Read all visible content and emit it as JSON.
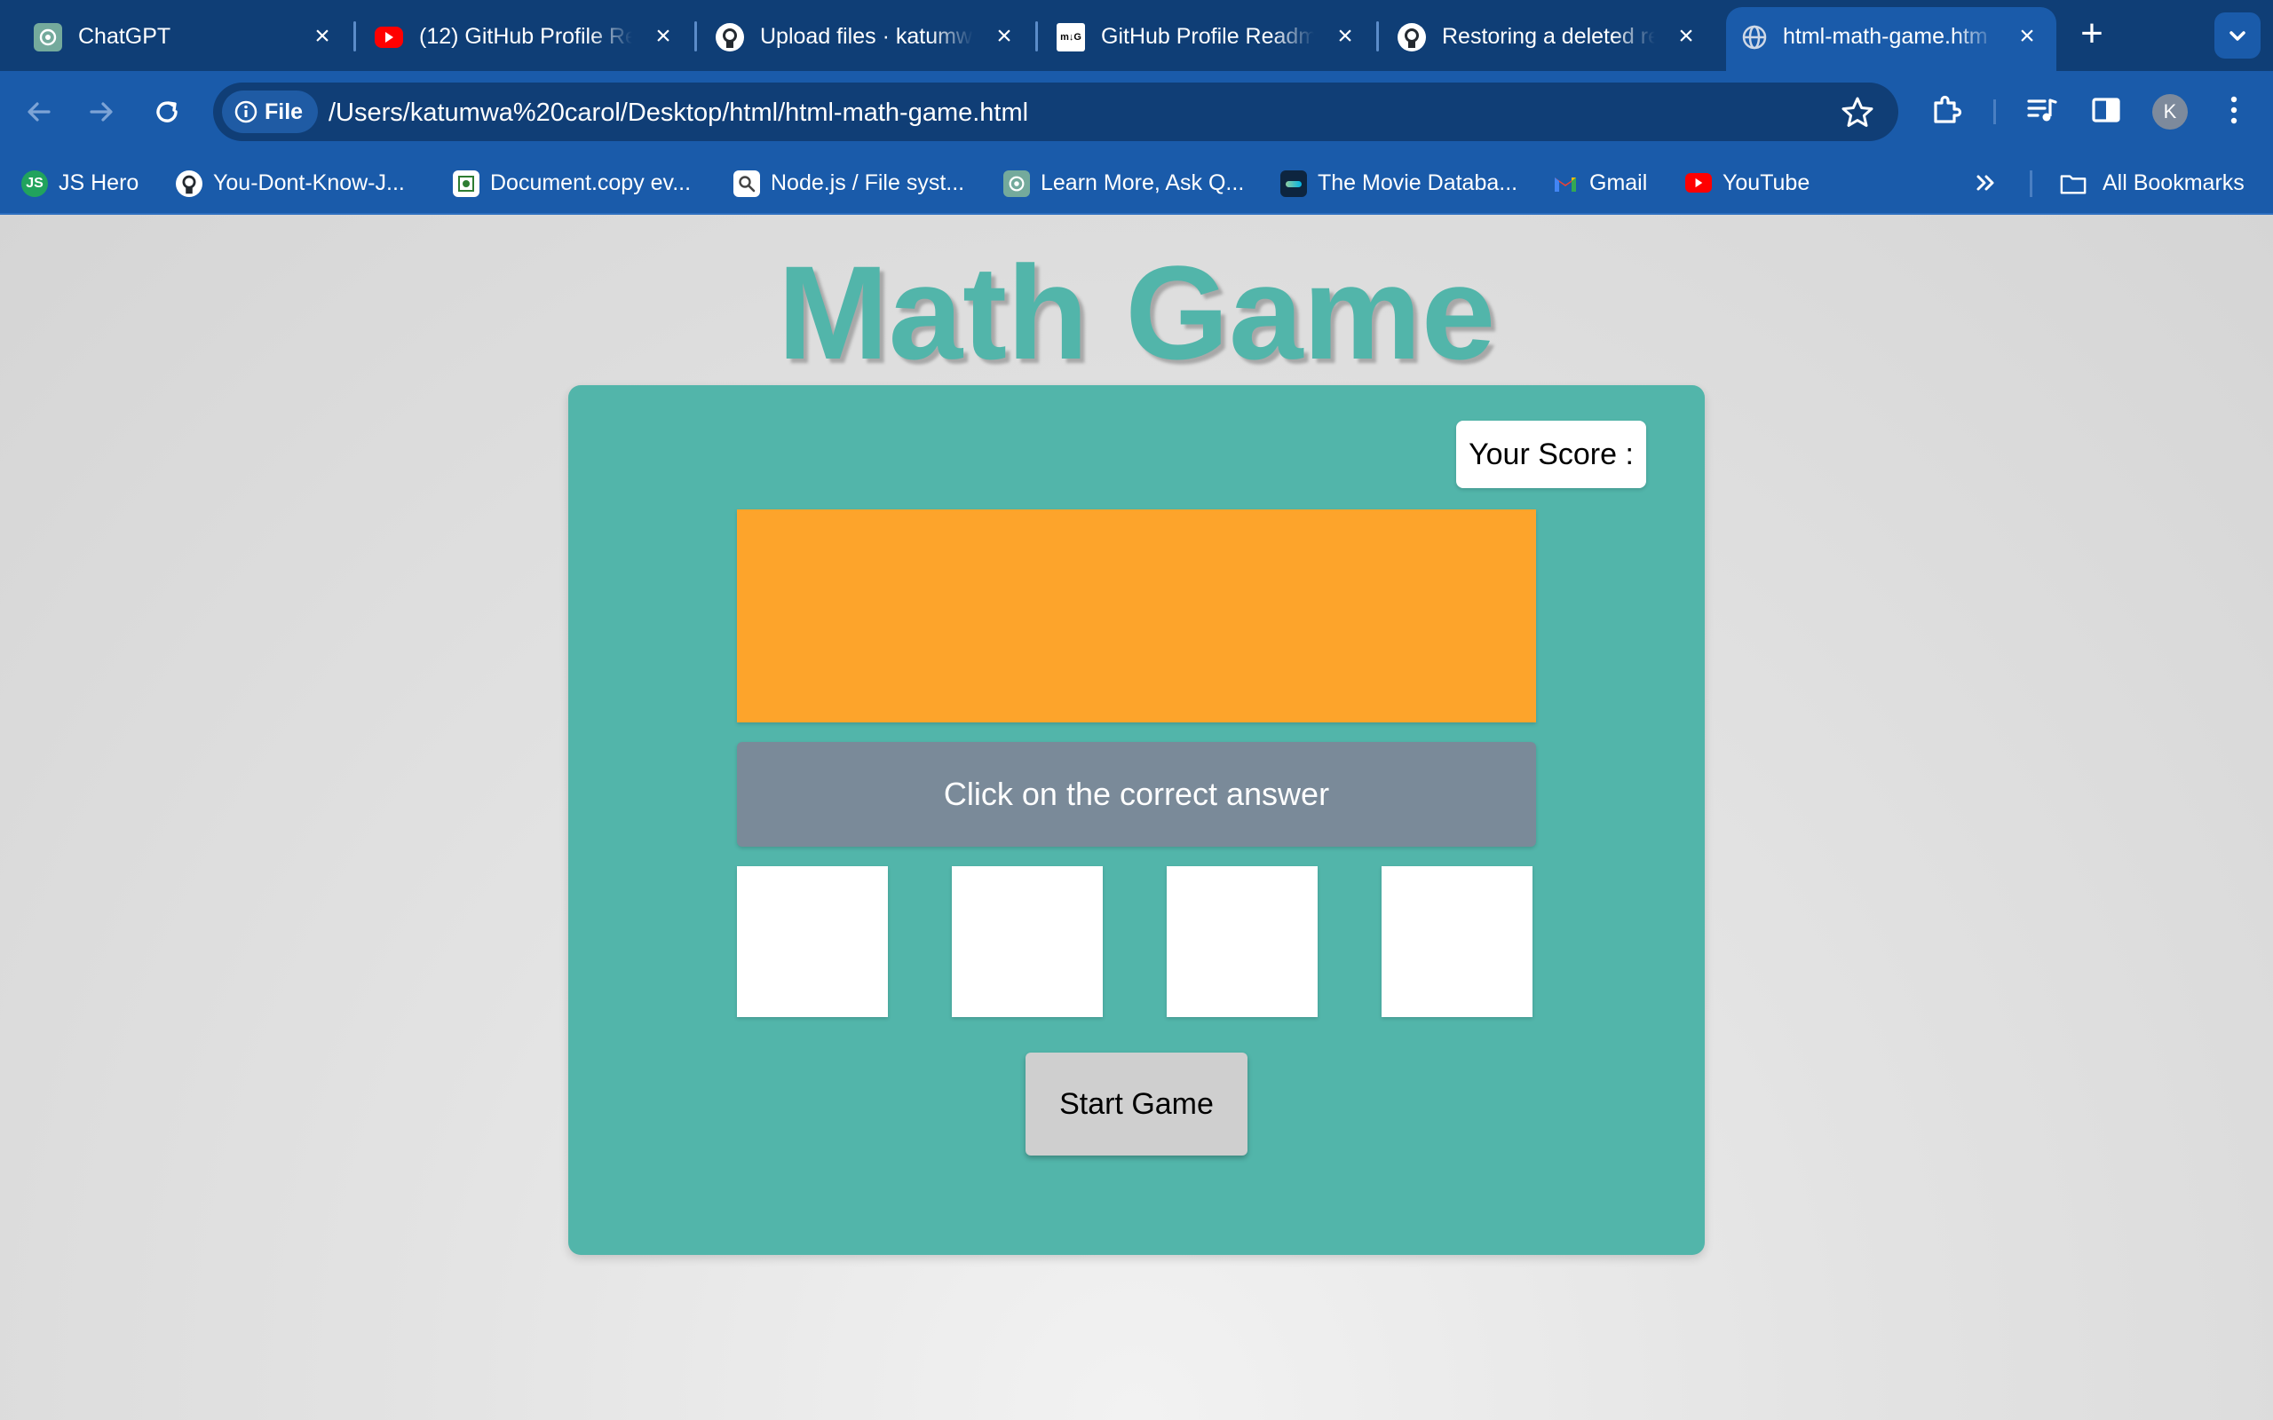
{
  "browser": {
    "tabs": [
      {
        "title": "ChatGPT",
        "icon": "chatgpt-icon",
        "active": false
      },
      {
        "title": "(12) GitHub Profile Re",
        "icon": "youtube-icon",
        "active": false
      },
      {
        "title": "Upload files · katumw",
        "icon": "github-icon",
        "active": false
      },
      {
        "title": "GitHub Profile Readm",
        "icon": "markdown-icon",
        "active": false
      },
      {
        "title": "Restoring a deleted re",
        "icon": "github-icon",
        "active": false
      },
      {
        "title": "html-math-game.htm",
        "icon": "globe-icon",
        "active": true
      }
    ],
    "address": {
      "chip_label": "File",
      "url": "/Users/katumwa%20carol/Desktop/html/html-math-game.html"
    },
    "profile_initial": "K",
    "bookmarks": [
      {
        "label": "JS Hero",
        "icon": "js-hero-icon"
      },
      {
        "label": "You-Dont-Know-J...",
        "icon": "github-icon"
      },
      {
        "label": "Document.copy ev...",
        "icon": "document-icon"
      },
      {
        "label": "Node.js / File syst...",
        "icon": "search-doc-icon"
      },
      {
        "label": "Learn More, Ask Q...",
        "icon": "chatgpt-icon"
      },
      {
        "label": "The Movie Databa...",
        "icon": "tmdb-icon"
      },
      {
        "label": "Gmail",
        "icon": "gmail-icon"
      },
      {
        "label": "YouTube",
        "icon": "youtube-icon"
      }
    ],
    "all_bookmarks_label": "All Bookmarks"
  },
  "page": {
    "title": "Math Game",
    "score_label": "Your Score :",
    "question": "",
    "instruction": "Click on the correct answer",
    "choices": [
      "",
      "",
      "",
      ""
    ],
    "start_button": "Start Game"
  },
  "colors": {
    "tabbar": "#0f3e76",
    "toolbar": "#1a5baa",
    "accent_teal": "#52b5aa",
    "question_orange": "#fda42b",
    "instruction_gray": "#7a8a99",
    "button_gray": "#cfcfcf"
  }
}
